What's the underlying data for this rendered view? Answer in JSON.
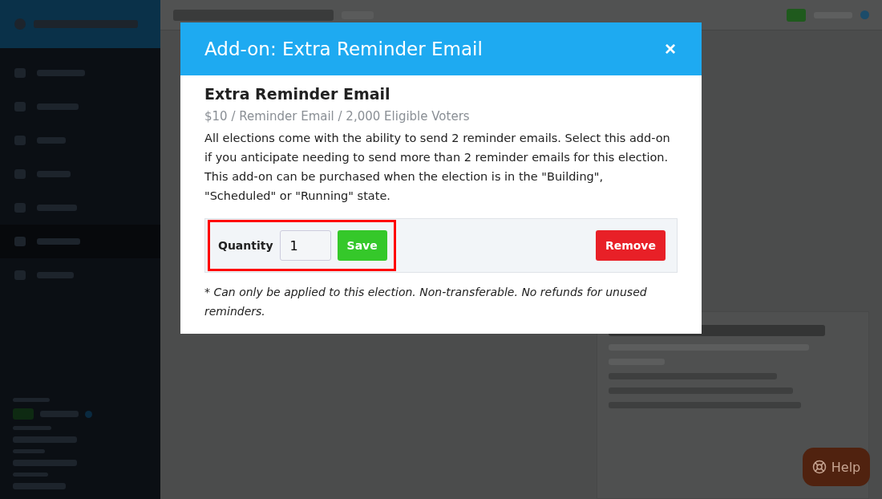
{
  "modal": {
    "title": "Add-on: Extra Reminder Email",
    "close": "×",
    "heading": "Extra Reminder Email",
    "price": "$10 / Reminder Email / 2,000 Eligible Voters",
    "description": "All elections come with the ability to send 2 reminder emails. Select this add-on if you anticipate needing to send more than 2 reminder emails for this election. This add-on can be purchased when the election is in the \"Building\", \"Scheduled\" or \"Running\" state.",
    "quantity_label": "Quantity",
    "quantity": "1",
    "save": "Save",
    "remove": "Remove",
    "highlighted": true,
    "footnote": "* Can only be applied to this election. Non-transferable. No refunds for unused reminders."
  },
  "help": "Help"
}
